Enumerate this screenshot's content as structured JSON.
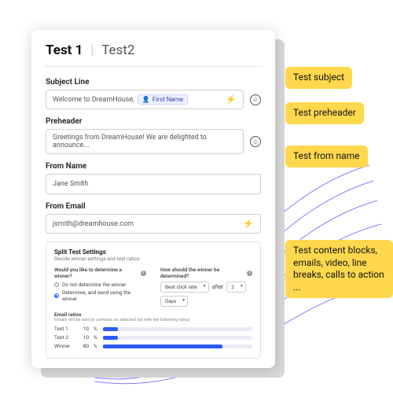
{
  "tabs": {
    "t1": "Test 1",
    "sep": "|",
    "t2": "Test2"
  },
  "subject": {
    "label": "Subject Line",
    "value": "Welcome to DreamHouse,",
    "token": "First Name"
  },
  "preheader": {
    "label": "Preheader",
    "value": "Greetings from DreamHouse! We are delighted to announce..."
  },
  "fromName": {
    "label": "From Name",
    "value": "Jane Smith"
  },
  "fromEmail": {
    "label": "From Email",
    "value": "jsmith@dreamhouse.com"
  },
  "settings": {
    "title": "Split Test Settings",
    "subtitle": "Decide winner settings and test ratios",
    "q1": "Would you like to determine a winner?",
    "opt1": "Do not determine the winner",
    "opt2": "Determine, and send using the winner",
    "q2": "How should the winner be determined?",
    "sel1": "Best click rate",
    "sel2_label": "after",
    "sel2": "2",
    "sel3": "Days",
    "ratios_title": "Email ratios",
    "ratios_sub": "Emails will be sent to contacts on selected list with the following ratios",
    "rows": [
      {
        "name": "Test 1",
        "pct": 10
      },
      {
        "name": "Test 2",
        "pct": 10
      },
      {
        "name": "Winner",
        "pct": 80
      }
    ]
  },
  "annotations": {
    "a1": "Test subject",
    "a2": "Test preheader",
    "a3": "Test from name",
    "a4": "Test content blocks, emails, video, line breaks, calls to action ..."
  },
  "colors": {
    "accent": "#2b5cff",
    "highlight": "#ffd84d"
  }
}
